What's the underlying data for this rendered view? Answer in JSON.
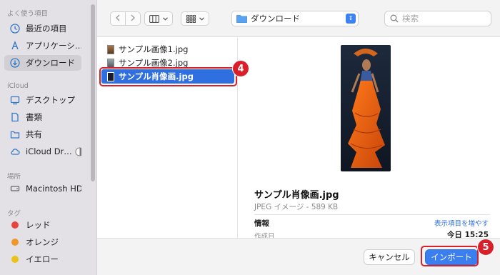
{
  "sidebar": {
    "sections": {
      "favorites": "よく使う項目",
      "icloud": "iCloud",
      "locations": "場所",
      "tags": "タグ"
    },
    "favorites": [
      {
        "label": "最近の項目",
        "icon": "clock-icon"
      },
      {
        "label": "アプリケーシ…",
        "icon": "apps-icon"
      },
      {
        "label": "ダウンロード",
        "icon": "download-icon",
        "selected": true
      }
    ],
    "icloud": [
      {
        "label": "デスクトップ",
        "icon": "desktop-icon"
      },
      {
        "label": "書類",
        "icon": "document-icon"
      },
      {
        "label": "共有",
        "icon": "shared-folder-icon"
      },
      {
        "label": "iCloud Dr…",
        "icon": "cloud-icon"
      }
    ],
    "locations": [
      {
        "label": "Macintosh HD",
        "icon": "disk-icon"
      }
    ],
    "tags": [
      {
        "label": "レッド",
        "color": "#e5453b"
      },
      {
        "label": "オレンジ",
        "color": "#f0962b"
      },
      {
        "label": "イエロー",
        "color": "#e9c21a"
      }
    ]
  },
  "toolbar": {
    "back_icon": "chevron-left-icon",
    "forward_icon": "chevron-right-icon",
    "view_columns_icon": "columns-icon",
    "view_grid_icon": "grid-icon",
    "location": "ダウンロード",
    "search_placeholder": "検索"
  },
  "files": [
    {
      "name": "サンプル画像1.jpg",
      "selected": false
    },
    {
      "name": "サンプル画像2.jpg",
      "selected": false
    },
    {
      "name": "サンプル肖像画.jpg",
      "selected": true
    }
  ],
  "preview": {
    "name": "サンプル肖像画.jpg",
    "kind": "JPEG イメージ - 589 KB",
    "info_label": "情報",
    "show_more": "表示項目を増やす",
    "created_label": "作成日",
    "created_value": "今日 15:25"
  },
  "footer": {
    "cancel_label": "キャンセル",
    "import_label": "インポート"
  },
  "annotations": {
    "step4": "4",
    "step5": "5",
    "color": "#d9202a"
  },
  "colors": {
    "accent": "#2f6fe0",
    "sidebar_bg": "#e4e1e6"
  }
}
